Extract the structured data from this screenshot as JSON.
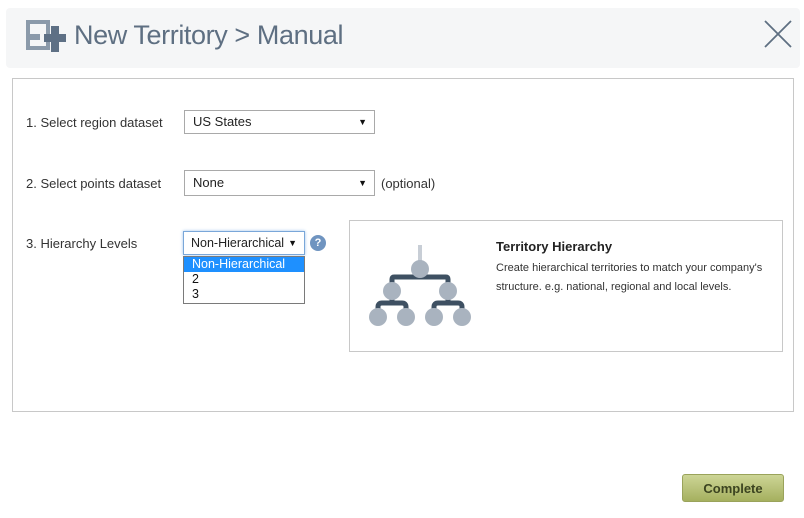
{
  "header": {
    "title": "New Territory > Manual",
    "icon": "territory-add-icon",
    "close_icon": "close-icon"
  },
  "form": {
    "region_label": "1. Select region dataset",
    "region_value": "US States",
    "points_label": "2. Select points dataset",
    "points_value": "None",
    "points_optional": "(optional)",
    "hierarchy_label": "3. Hierarchy Levels",
    "hierarchy_value": "Non-Hierarchical",
    "help_symbol": "?"
  },
  "dropdown": {
    "options": [
      "Non-Hierarchical",
      "2",
      "3"
    ],
    "selected_index": 0
  },
  "info": {
    "title": "Territory Hierarchy",
    "text": "Create hierarchical territories to match your company's structure. e.g. national, regional and local levels."
  },
  "footer": {
    "complete_label": "Complete"
  },
  "colors": {
    "title": "#5e6f82",
    "accent_button": "#b7c178",
    "dropdown_highlight": "#1e90ff",
    "hierarchy_nodes": "#a9b3bf",
    "hierarchy_lines": "#3e5062"
  }
}
